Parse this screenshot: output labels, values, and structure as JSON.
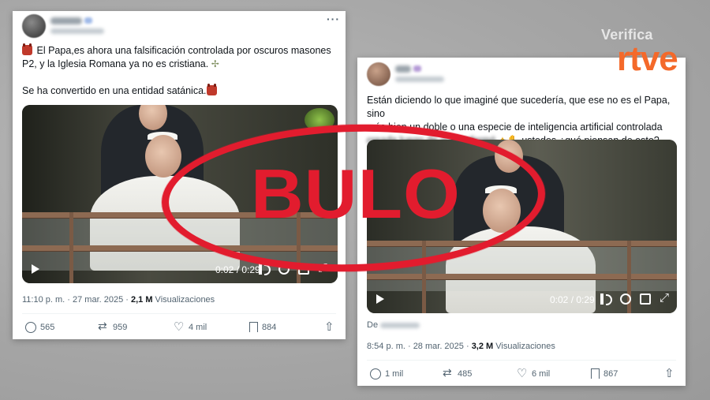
{
  "brand": {
    "top": "Verifica",
    "main": "rtve",
    "color": "#f4692a"
  },
  "stamp": {
    "text": "BULO",
    "color": "#e21c2e"
  },
  "posts": [
    {
      "text_line1": "El Papa,es ahora una falsificación controlada por oscuros masones",
      "text_line2": "P2, y la Iglesia Romana ya no es cristiana.",
      "text_line3": "Se ha convertido en una entidad satánica.",
      "video_time": "0:02 / 0:29",
      "timestamp": "11:10 p. m. · 27 mar. 2025 · ",
      "views_count": "2,1 M",
      "views_label": " Visualizaciones",
      "replies": "565",
      "retweets": "959",
      "likes": "4 mil",
      "bookmarks": "884"
    },
    {
      "text_line1": "Están diciendo lo que imaginé que sucedería, que ese no es el Papa, sino",
      "text_line2": "más bien un doble o una especie de inteligencia artificial controlada",
      "text_line3_blurred": "creada luego de que enfermó",
      "text_line3": " ustedes ¿qué piensan de esto?",
      "video_time": "0:02 / 0:29",
      "from_label": "De",
      "timestamp": "8:54 p. m. · 28 mar. 2025 · ",
      "views_count": "3,2 M",
      "views_label": " Visualizaciones",
      "replies": "1 mil",
      "retweets": "485",
      "likes": "6 mil",
      "bookmarks": "867"
    }
  ]
}
